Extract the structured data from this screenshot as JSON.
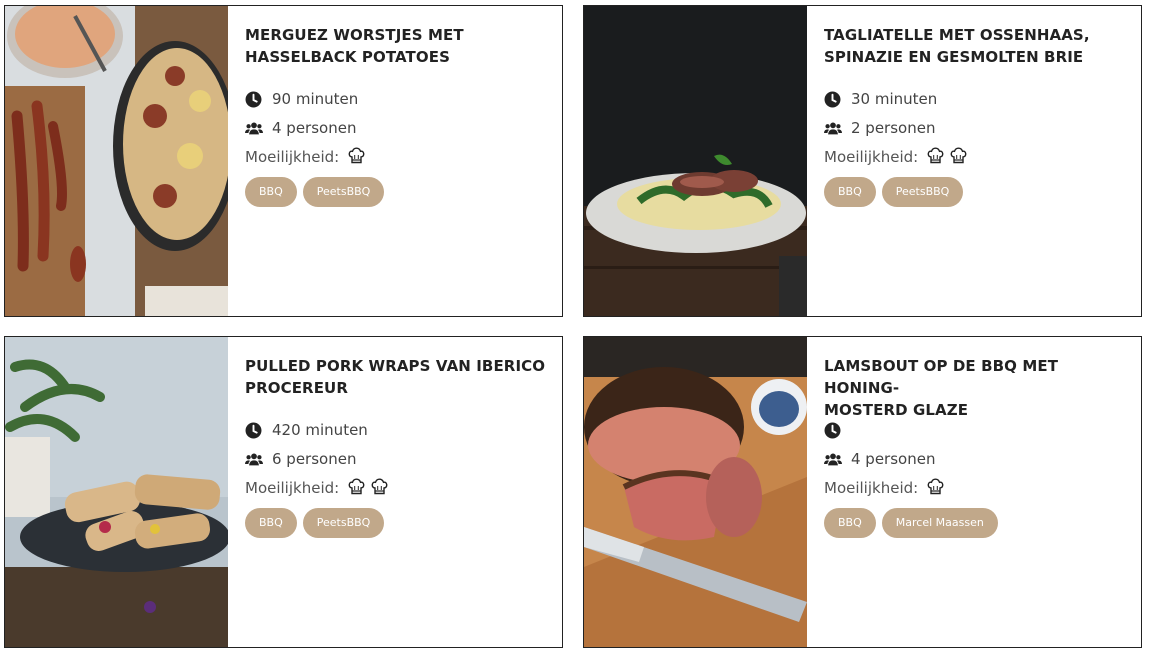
{
  "labels": {
    "difficulty": "Moeilijkheid:"
  },
  "colors": {
    "tag_bg": "#c1a88a",
    "tag_text": "#ffffff",
    "icon": "#222222"
  },
  "recipes": [
    {
      "title_line1": "MERGUEZ WORSTJES MET",
      "title_line2": "HASSELBACK POTATOES",
      "time": "90 minuten",
      "persons": "4 personen",
      "difficulty_level": 1,
      "tags": [
        "BBQ",
        "PeetsBBQ"
      ],
      "image": "merguez sausages and hasselback potatoes in skillet"
    },
    {
      "title_line1": "TAGLIATELLE MET OSSENHAAS,",
      "title_line2": "SPINAZIE EN GESMOLTEN BRIE",
      "time": "30 minuten",
      "persons": "2 personen",
      "difficulty_level": 2,
      "tags": [
        "BBQ",
        "PeetsBBQ"
      ],
      "image": "plate of tagliatelle with sliced beef"
    },
    {
      "title_line1": "PULLED PORK WRAPS VAN IBERICO",
      "title_line2": "PROCEREUR",
      "time": "420 minuten",
      "persons": "6 personen",
      "difficulty_level": 2,
      "tags": [
        "BBQ",
        "PeetsBBQ"
      ],
      "image": "pulled pork wraps on dark plate"
    },
    {
      "title_line1": "LAMSBOUT OP DE BBQ MET HONING-",
      "title_line2": "MOSTERD GLAZE",
      "time": "",
      "persons": "4 personen",
      "difficulty_level": 1,
      "tags": [
        "BBQ",
        "Marcel Maassen"
      ],
      "image": "sliced leg of lamb on cutting board with knife"
    }
  ]
}
